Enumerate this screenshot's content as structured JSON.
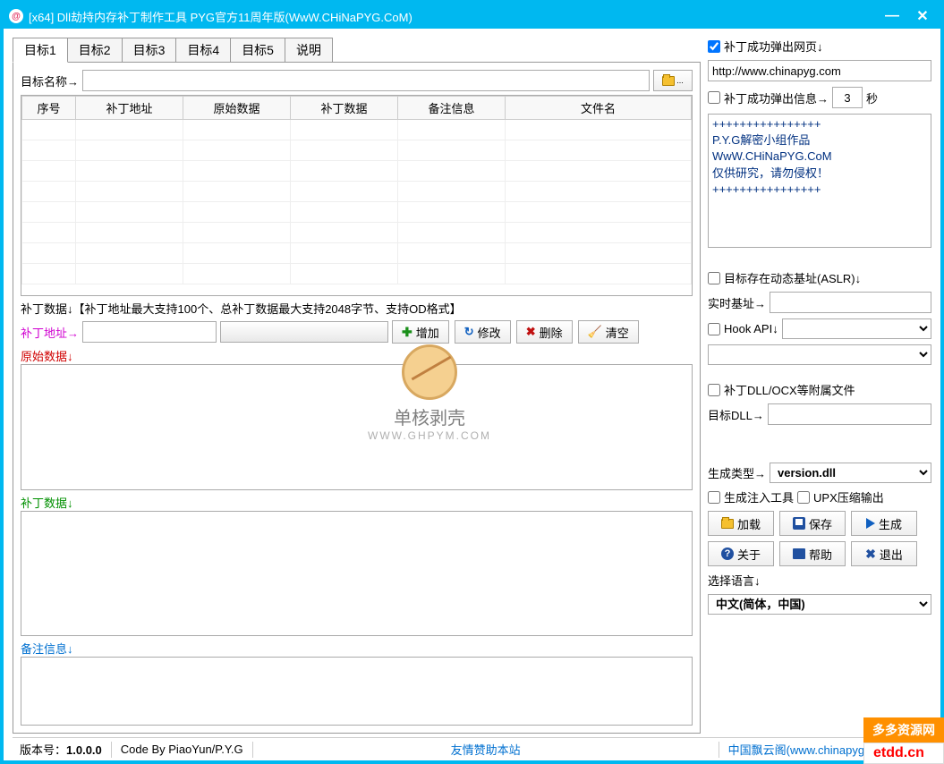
{
  "titlebar": {
    "text": "[x64]  Dll劫持内存补丁制作工具   PYG官方11周年版(WwW.CHiNaPYG.CoM)"
  },
  "tabs": [
    "目标1",
    "目标2",
    "目标3",
    "目标4",
    "目标5",
    "说明"
  ],
  "targetNameLabel": "目标名称→",
  "targetNameValue": "",
  "columns": [
    "序号",
    "补丁地址",
    "原始数据",
    "补丁数据",
    "备注信息",
    "文件名"
  ],
  "hint": "补丁数据↓【补丁地址最大支持100个、总补丁数据最大支持2048字节、支持OD格式】",
  "patchAddrLabel": "补丁地址→",
  "patchAddrValue": "",
  "actions": {
    "add": "增加",
    "modify": "修改",
    "delete": "删除",
    "clear": "清空"
  },
  "origDataLabel": "原始数据↓",
  "patchDataLabel": "补丁数据↓",
  "remarkLabel": "备注信息↓",
  "right": {
    "popupWebChk": "补丁成功弹出网页↓",
    "popupWebVal": "http://www.chinapyg.com",
    "popupInfoChk": "补丁成功弹出信息→",
    "secondsVal": "3",
    "secondsUnit": "秒",
    "infoText": "++++++++++++++++\nP.Y.G解密小组作品\nWwW.CHiNaPYG.CoM\n仅供研究，请勿侵权！\n++++++++++++++++",
    "aslrChk": "目标存在动态基址(ASLR)↓",
    "realBaseLabel": "实时基址→",
    "realBaseVal": "",
    "hookApiChk": "Hook API↓",
    "hookApiSel": "",
    "hookApiSel2": "",
    "dllOcxChk": "补丁DLL/OCX等附属文件",
    "targetDllLabel": "目标DLL→",
    "targetDllVal": "",
    "genTypeLabel": "生成类型→",
    "genTypeSel": "version.dll",
    "genInjectChk": "生成注入工具",
    "upxChk": "UPX压缩输出",
    "buttons": {
      "load": "加载",
      "save": "保存",
      "gen": "生成",
      "about": "关于",
      "help": "帮助",
      "exit": "退出"
    },
    "langLabel": "选择语言↓",
    "langSel": "中文(简体，中国)"
  },
  "status": {
    "versionLabel": "版本号：",
    "version": "1.0.0.0",
    "author": "Code By PiaoYun/P.Y.G",
    "sponsor": "友情赞助本站",
    "siteText": "中国飘云阁(www.chinapyg.com | www"
  },
  "watermark": {
    "cn": "单核剥壳",
    "en": "WWW.GHPYM.COM"
  },
  "badges": {
    "b1": "多多资源网",
    "b2": "etdd.cn"
  }
}
